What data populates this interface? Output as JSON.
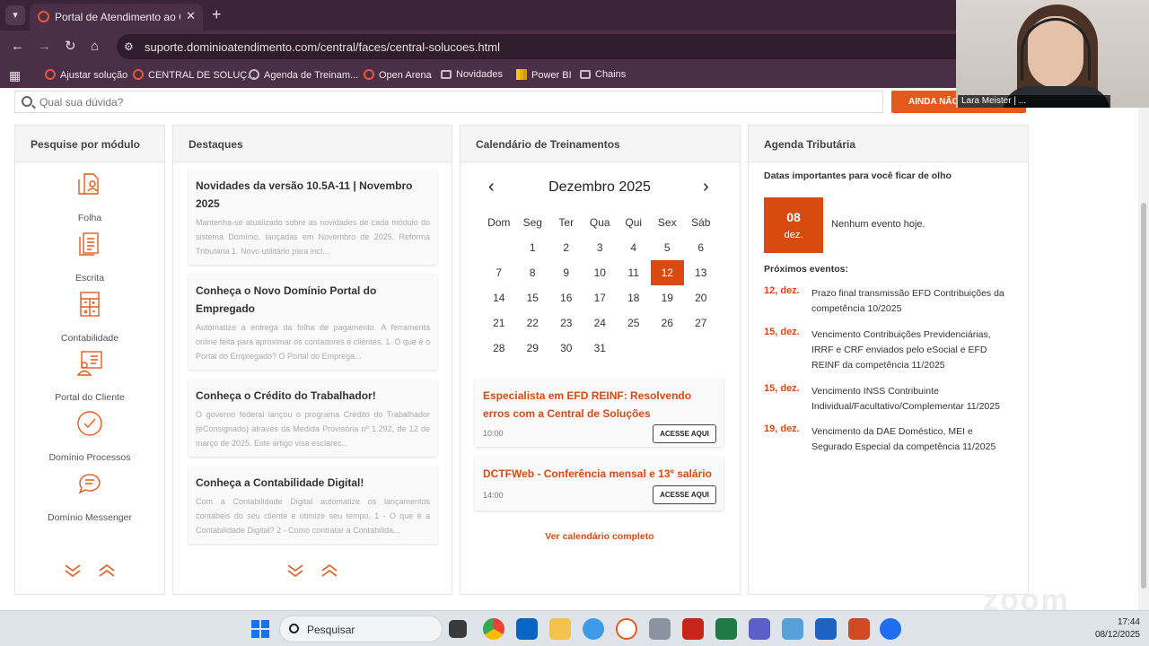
{
  "browser": {
    "tab_title": "Portal de Atendimento ao Cliente",
    "url": "suporte.dominioatendimento.com/central/faces/central-solucoes.html",
    "bookmarks": [
      {
        "label": "Ajustar solução",
        "icon": "red-circle-icon"
      },
      {
        "label": "CENTRAL DE SOLUÇ...",
        "icon": "red-circle-icon"
      },
      {
        "label": "Agenda de Treinam...",
        "icon": "globe-icon"
      },
      {
        "label": "Open Arena",
        "icon": "red-circle-icon"
      },
      {
        "label": "Novidades",
        "icon": "folder-icon"
      },
      {
        "label": "Power BI",
        "icon": "powerbi-icon"
      },
      {
        "label": "Chains",
        "icon": "folder-icon"
      }
    ]
  },
  "search": {
    "placeholder": "Qual sua dúvida?",
    "button_label": "AINDA NÃO..."
  },
  "modules": {
    "title": "Pesquise por módulo",
    "items": [
      {
        "label": "Folha",
        "icon": "folha-icon"
      },
      {
        "label": "Escrita",
        "icon": "escrita-icon"
      },
      {
        "label": "Contabilidade",
        "icon": "calculator-icon"
      },
      {
        "label": "Portal do Cliente",
        "icon": "portal-icon"
      },
      {
        "label": "Domínio Processos",
        "icon": "check-circle-icon"
      },
      {
        "label": "Domínio Messenger",
        "icon": "chat-icon"
      }
    ]
  },
  "highlights": {
    "title": "Destaques",
    "items": [
      {
        "title": "Novidades da versão 10.5A-11 | Novembro 2025",
        "body": "Mantenha-se atualizado sobre as novidades de cada módulo do sistema Domínio, lançadas em Novembro de 2025.      Reforma Tributária   1. Novo utilitário para incl..."
      },
      {
        "title": "Conheça o Novo Domínio Portal do Empregado",
        "body": "Automatize a entrega da folha de pagamento. A ferramenta online feita para aproximar os contadores e clientes.    1. O que é o Portal do Empregado?    O Portal do Emprega..."
      },
      {
        "title": "Conheça o Crédito do Trabalhador!",
        "body": "O governo federal lançou o programa Crédito do Trabalhador (eConsignado) através da Medida Provisória nº 1.292, de 12 de março de 2025. Este artigo visa esclarec..."
      },
      {
        "title": "Conheça a Contabilidade Digital!",
        "body": "Com a Contabilidade Digital automatize os lançamentos contábeis do seu cliente e otimize seu tempo.  1 - O que é a Contabilidade Digital? 2 - Como contratar a Contabilida..."
      }
    ]
  },
  "calendar": {
    "title": "Calendário de Treinamentos",
    "month": "Dezembro 2025",
    "prev": "‹",
    "next": "›",
    "weekdays": [
      "Dom",
      "Seg",
      "Ter",
      "Qua",
      "Qui",
      "Sex",
      "Sáb"
    ],
    "first_weekday_offset": 1,
    "days": 31,
    "highlight_day": 12,
    "events": [
      {
        "title": "Especialista em EFD REINF: Resolvendo erros com a Central de Soluções",
        "time": "10:00",
        "button": "ACESSE AQUI"
      },
      {
        "title": "DCTFWeb - Conferência mensal e 13º salário",
        "time": "14:00",
        "button": "ACESSE AQUI"
      }
    ],
    "link": "Ver calendário completo"
  },
  "agenda": {
    "title": "Agenda Tributária",
    "subtitle": "Datas importantes para você ficar de olho",
    "today_day": "08",
    "today_month": "dez.",
    "no_event": "Nenhum evento hoje.",
    "next_label": "Próximos eventos:",
    "events": [
      {
        "date": "12, dez.",
        "text": "Prazo final transmissão EFD Contribuições da competência 10/2025"
      },
      {
        "date": "15, dez.",
        "text": "Vencimento Contribuições Previdenciárias, IRRF e CRF enviados pelo eSocial e EFD REINF da competência 11/2025"
      },
      {
        "date": "15, dez.",
        "text": "Vencimento INSS Contribuinte Individual/Facultativo/Complementar 11/2025"
      },
      {
        "date": "19, dez.",
        "text": "Vencimento da DAE Doméstico, MEI e Segurado Especial da competência 11/2025"
      }
    ]
  },
  "webcam": {
    "name": "Lara Meister | ..."
  },
  "watermark": "zoom",
  "taskbar": {
    "search_label": "Pesquisar",
    "time": "17:44",
    "date": "08/12/2025"
  },
  "colors": {
    "accent": "#d84a10",
    "button": "#e45a1c",
    "browser": "#4a2f47"
  }
}
